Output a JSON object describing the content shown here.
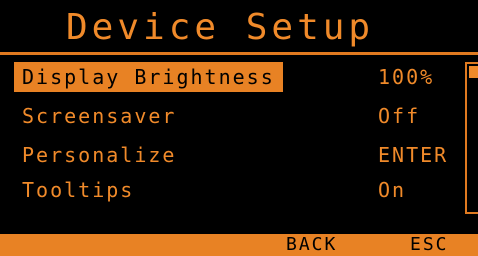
{
  "header": {
    "title": "Device Setup"
  },
  "menu": {
    "items": [
      {
        "label": "Display Brightness",
        "value": "100%",
        "selected": true
      },
      {
        "label": "Screensaver",
        "value": "Off",
        "selected": false
      },
      {
        "label": "Personalize",
        "value": "ENTER",
        "selected": false
      },
      {
        "label": "Tooltips",
        "value": "On",
        "selected": false
      }
    ]
  },
  "footer": {
    "back_label": "BACK",
    "esc_label": "ESC"
  },
  "colors": {
    "accent": "#f08a2a",
    "highlight": "#e88224",
    "background": "#000000"
  }
}
